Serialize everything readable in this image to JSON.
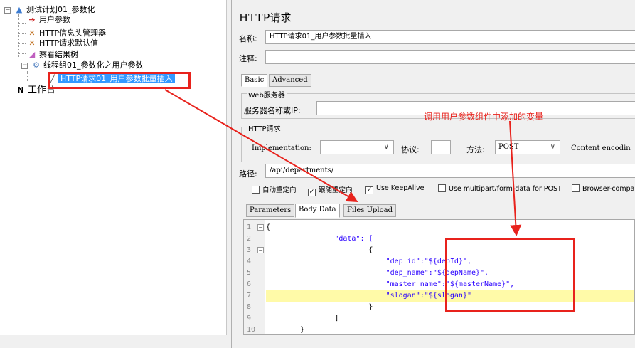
{
  "tree": {
    "items": [
      {
        "label": "测试计划01_参数化",
        "icon": "test-plan-icon"
      },
      {
        "label": "用户参数",
        "icon": "user-params-icon"
      },
      {
        "label": "HTTP信息头管理器",
        "icon": "wrench-icon"
      },
      {
        "label": "HTTP请求默认值",
        "icon": "wrench-icon"
      },
      {
        "label": "察看结果树",
        "icon": "results-tree-icon"
      },
      {
        "label": "线程组01_参数化之用户参数",
        "icon": "thread-group-icon"
      },
      {
        "label": "HTTP请求01_用户参数批量插入",
        "icon": "sampler-icon"
      },
      {
        "label": "工作台",
        "icon": "workbench-icon"
      }
    ]
  },
  "panel": {
    "title": "HTTP请求",
    "name_label": "名称:",
    "name_value": "HTTP请求01_用户参数批量插入",
    "comment_label": "注释:",
    "comment_value": "",
    "tabs": [
      "Basic",
      "Advanced"
    ],
    "web_server_group": "Web服务器",
    "server_label": "服务器名称或IP:",
    "server_value": "",
    "http_request_group": "HTTP请求",
    "implementation_label": "Implementation:",
    "implementation_value": "",
    "protocol_label": "协议:",
    "protocol_value": "",
    "method_label": "方法:",
    "method_value": "POST",
    "content_encoding_label": "Content encodin",
    "path_label": "路径:",
    "path_value": "/api/departments/",
    "checkboxes": [
      {
        "label": "自动重定向",
        "checked": false
      },
      {
        "label": "跟随重定向",
        "checked": true
      },
      {
        "label": "Use KeepAlive",
        "checked": true
      },
      {
        "label": "Use multipart/form-data for POST",
        "checked": false
      },
      {
        "label": "Browser-compa",
        "checked": false
      }
    ],
    "subtabs": [
      "Parameters",
      "Body Data",
      "Files Upload"
    ],
    "active_subtab": "Body Data"
  },
  "editor": {
    "line_numbers": [
      "1",
      "2",
      "3",
      "4",
      "5",
      "6",
      "7",
      "8",
      "9",
      "10"
    ],
    "lines": [
      "{",
      "                \"data\": [",
      "                        {",
      "                            \"dep_id\":\"${depId}\",",
      "                            \"dep_name\":\"${depName}\",",
      "                            \"master_name\":\"${masterName}\",",
      "                            \"slogan\":\"${slogan}\"",
      "                        }",
      "                ]",
      "        }"
    ],
    "highlighted_line": 7
  },
  "annotation": {
    "text": "调用用户参数组件中添加的变量",
    "color": "#e8221c"
  }
}
